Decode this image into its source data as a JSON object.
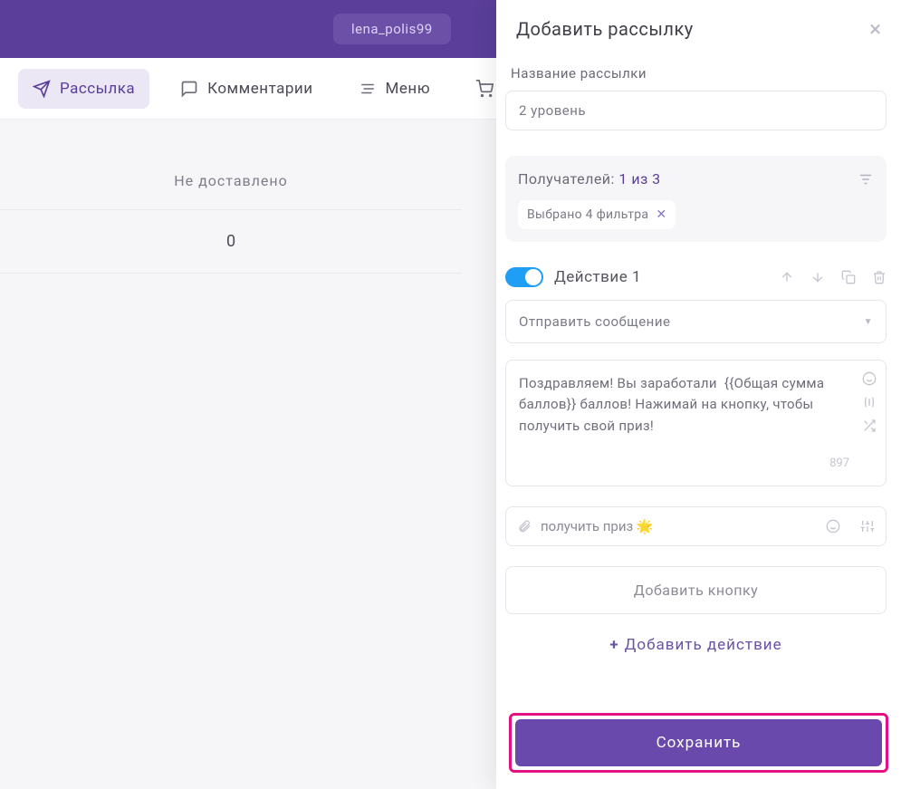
{
  "topbar": {
    "account": "lena_polis99"
  },
  "tabs": {
    "broadcast": "Рассылка",
    "comments": "Комментарии",
    "menu": "Меню"
  },
  "stats": {
    "head": "Не доставлено",
    "value": "0"
  },
  "modal": {
    "title": "Добавить рассылку",
    "name_label": "Название рассылки",
    "name_value": "2 уровень",
    "recipients_label": "Получателей: ",
    "recipients_count": "1 из 3",
    "filter_chip": "Выбрано 4 фильтра",
    "action_title": "Действие 1",
    "action_type": "Отправить сообщение",
    "message": "Поздравляем! Вы заработали  {{Общая сумма баллов}} баллов! Нажимай на кнопку, чтобы получить свой приз!",
    "char_count": "897",
    "button_label": "получить приз 🌟",
    "add_button": "Добавить кнопку",
    "add_action": "Добавить действие",
    "save": "Сохранить"
  }
}
